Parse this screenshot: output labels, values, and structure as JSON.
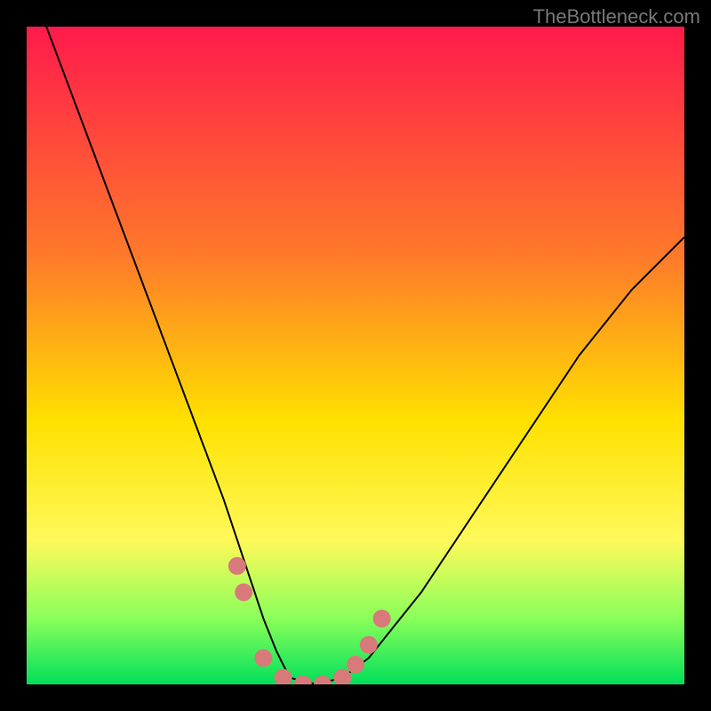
{
  "watermark": "TheBottleneck.com",
  "chart_data": {
    "type": "line",
    "title": "",
    "xlabel": "",
    "ylabel": "",
    "xlim": [
      0,
      100
    ],
    "ylim": [
      0,
      100
    ],
    "gradient_stops": [
      {
        "offset": 0,
        "color": "#ff1a4b"
      },
      {
        "offset": 35,
        "color": "#ff7a2a"
      },
      {
        "offset": 60,
        "color": "#ffe100"
      },
      {
        "offset": 78,
        "color": "#fff95a"
      },
      {
        "offset": 90,
        "color": "#8aff5a"
      },
      {
        "offset": 100,
        "color": "#00e05a"
      }
    ],
    "series": [
      {
        "name": "curve",
        "color": "#000000",
        "x": [
          3,
          6,
          9,
          12,
          15,
          18,
          21,
          24,
          27,
          30,
          32,
          34,
          36,
          38,
          40,
          44,
          48,
          52,
          56,
          60,
          64,
          68,
          72,
          76,
          80,
          84,
          88,
          92,
          96,
          100
        ],
        "y": [
          100,
          92,
          84,
          76,
          68,
          60,
          52,
          44,
          36,
          28,
          22,
          16,
          10,
          5,
          1,
          0,
          1,
          4,
          9,
          14,
          20,
          26,
          32,
          38,
          44,
          50,
          55,
          60,
          64,
          68
        ]
      }
    ],
    "markers": {
      "name": "bottom-markers",
      "color": "#d87a7a",
      "radius": 10,
      "points": [
        {
          "x": 32,
          "y": 18
        },
        {
          "x": 33,
          "y": 14
        },
        {
          "x": 36,
          "y": 4
        },
        {
          "x": 39,
          "y": 1
        },
        {
          "x": 42,
          "y": 0
        },
        {
          "x": 45,
          "y": 0
        },
        {
          "x": 48,
          "y": 1
        },
        {
          "x": 50,
          "y": 3
        },
        {
          "x": 52,
          "y": 6
        },
        {
          "x": 54,
          "y": 10
        }
      ]
    }
  }
}
